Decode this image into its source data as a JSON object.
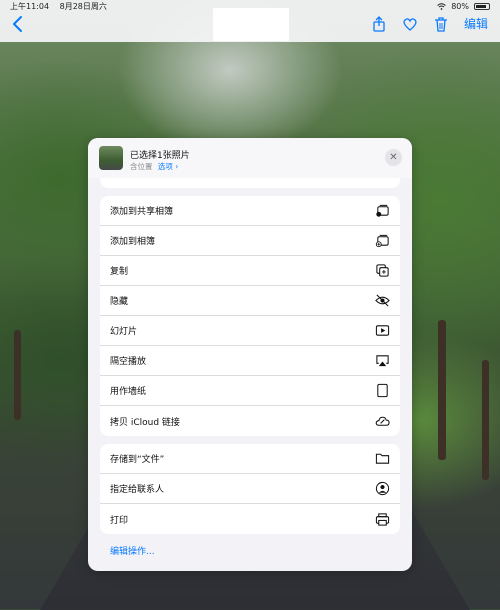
{
  "status_bar": {
    "time": "上午11:04",
    "date": "8月28日周六",
    "battery": "80%"
  },
  "nav": {
    "edit_label": "编辑",
    "icons": [
      "back-chevron-icon",
      "share-icon",
      "heart-icon",
      "trash-icon"
    ],
    "accent": "#0A7AFF"
  },
  "sheet": {
    "title": "已选择1张照片",
    "subtitle": "含位置",
    "options_label": "选项 ›",
    "groups": [
      {
        "items": [
          {
            "label": "添加到共享相簿",
            "icon": "shared-album-icon"
          },
          {
            "label": "添加到相簿",
            "icon": "add-album-icon"
          },
          {
            "label": "复制",
            "icon": "copy-icon"
          },
          {
            "label": "隐藏",
            "icon": "eye-slash-icon"
          },
          {
            "label": "幻灯片",
            "icon": "play-icon"
          },
          {
            "label": "隔空播放",
            "icon": "airplay-icon"
          },
          {
            "label": "用作墙纸",
            "icon": "device-icon"
          },
          {
            "label": "拷贝 iCloud 链接",
            "icon": "cloud-link-icon"
          }
        ]
      },
      {
        "items": [
          {
            "label": "存储到“文件”",
            "icon": "folder-icon"
          },
          {
            "label": "指定给联系人",
            "icon": "contact-icon"
          },
          {
            "label": "打印",
            "icon": "printer-icon"
          }
        ]
      }
    ],
    "edit_actions_label": "编辑操作..."
  }
}
